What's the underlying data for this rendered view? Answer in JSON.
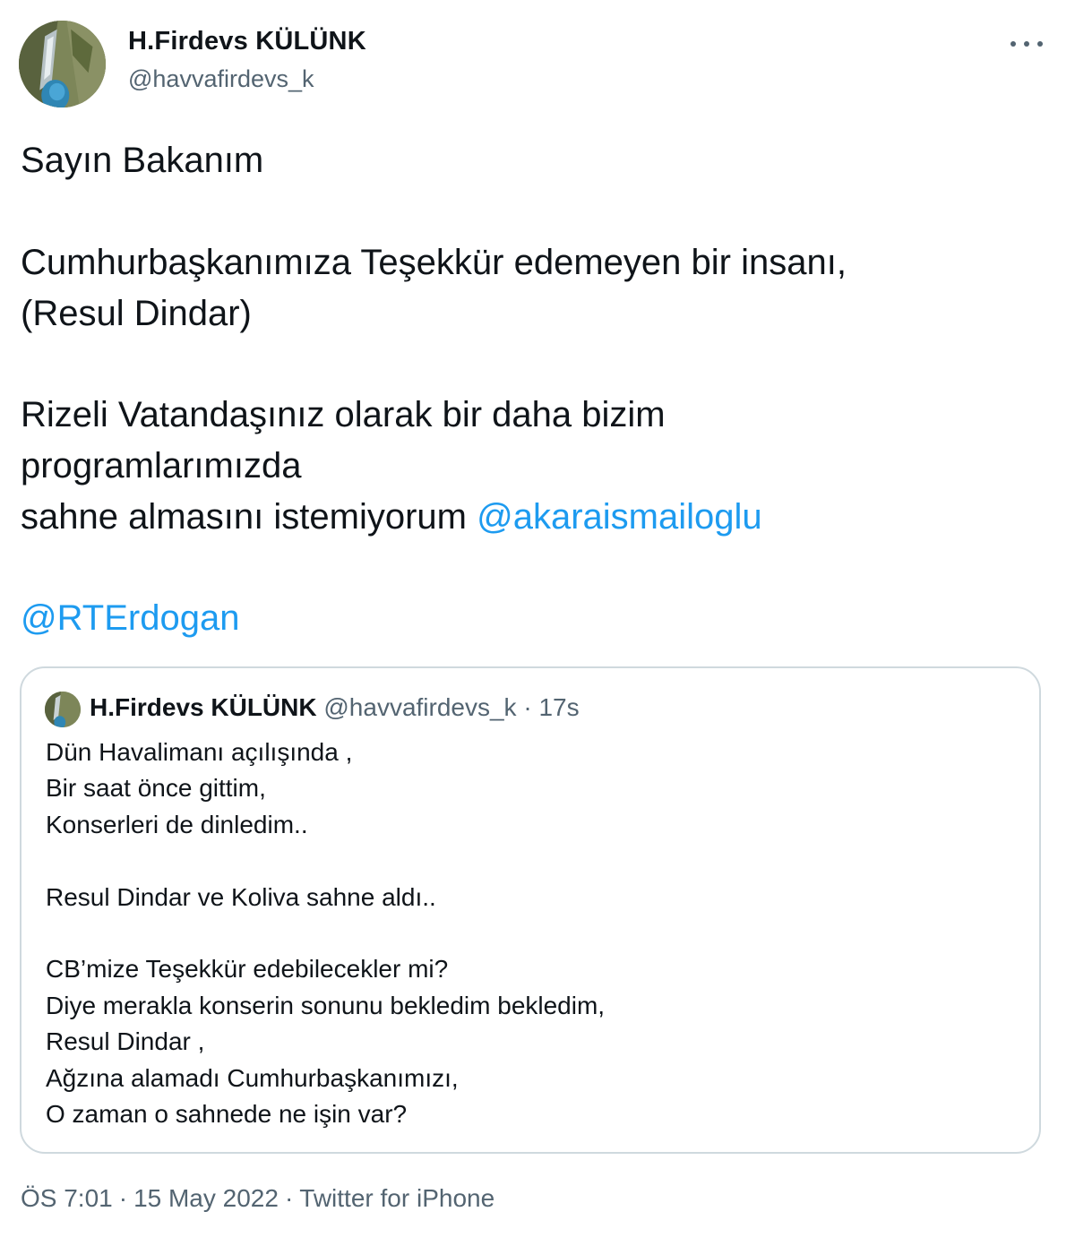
{
  "author": {
    "name": "H.Firdevs KÜLÜNK",
    "handle": "@havvafirdevs_k",
    "avatar_icon": "avatar-photo-icon"
  },
  "more_icon": "more-horizontal-icon",
  "tweet": {
    "line1": "Sayın Bakanım",
    "line2": "Cumhurbaşkanımıza Teşekkür edemeyen bir insanı,",
    "line3": "(Resul Dindar)",
    "line4": "Rizeli Vatandaşınız olarak bir daha bizim",
    "line5": "programlarımızda",
    "line6_text": "sahne almasını istemiyorum",
    "mention1": "@akaraismailoglu",
    "mention2": "@RTErdogan"
  },
  "quote": {
    "name": "H.Firdevs KÜLÜNK",
    "handle": "@havvafirdevs_k",
    "separator": "·",
    "time": "17s",
    "lines": [
      "Dün Havalimanı açılışında ,",
      "Bir saat önce gittim,",
      "Konserleri de dinledim..",
      "Resul Dindar ve Koliva sahne aldı..",
      "CB’mize Teşekkür edebilecekler mi?",
      "Diye merakla konserin sonunu bekledim bekledim,",
      "Resul Dindar ,",
      "Ağzına alamadı Cumhurbaşkanımızı,",
      "O zaman o sahnede ne işin var?"
    ]
  },
  "footer": {
    "time": "ÖS 7:01",
    "separator": "·",
    "date": "15 May 2022",
    "source": "Twitter for iPhone"
  },
  "colors": {
    "text": "#0f1419",
    "secondary": "#536471",
    "link": "#1d9bf0",
    "border": "#cfd9de"
  }
}
